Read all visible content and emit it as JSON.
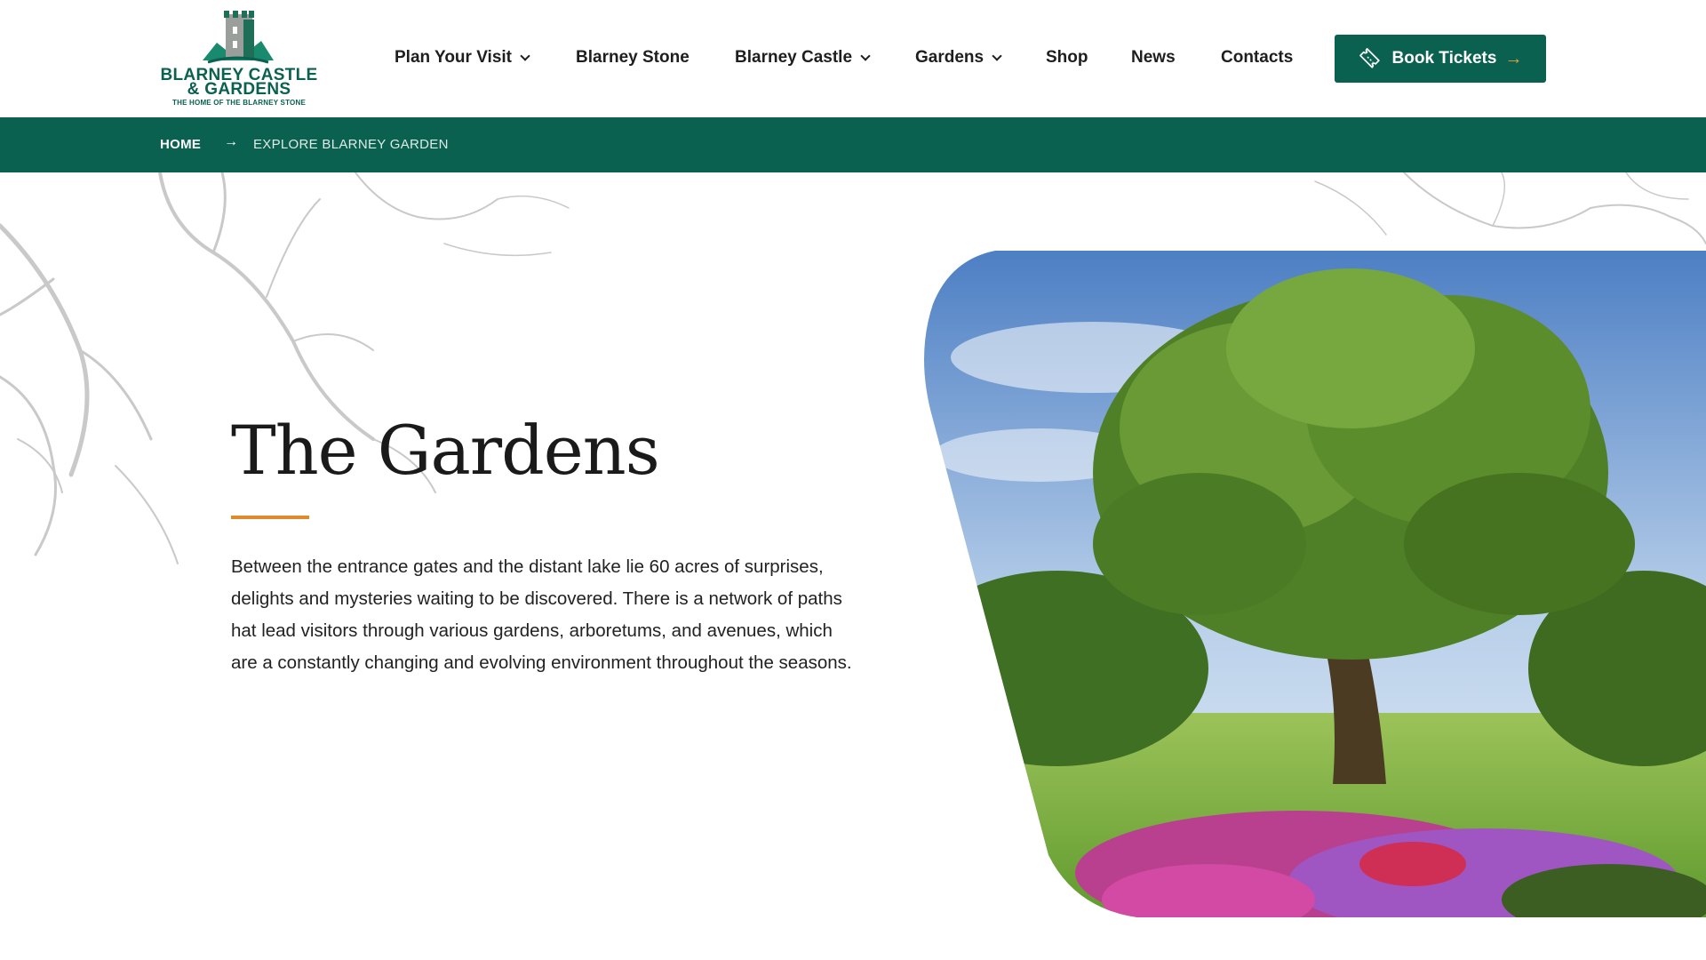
{
  "brand": {
    "name_line1": "BLARNEY CASTLE",
    "name_line2": "& GARDENS",
    "tagline": "THE HOME OF THE BLARNEY STONE",
    "colors": {
      "primary": "#0b6150",
      "accent": "#e08a2b"
    }
  },
  "nav": {
    "items": [
      {
        "label": "Plan Your Visit",
        "has_dropdown": true
      },
      {
        "label": "Blarney Stone",
        "has_dropdown": false
      },
      {
        "label": "Blarney Castle",
        "has_dropdown": true
      },
      {
        "label": "Gardens",
        "has_dropdown": true
      },
      {
        "label": "Shop",
        "has_dropdown": false
      },
      {
        "label": "News",
        "has_dropdown": false
      },
      {
        "label": "Contacts",
        "has_dropdown": false
      }
    ],
    "cta": {
      "label": "Book Tickets",
      "icon": "ticket-icon",
      "arrow_icon": "arrow-right-icon"
    }
  },
  "breadcrumb": {
    "home": "HOME",
    "separator": "→",
    "current": "EXPLORE BLARNEY GARDEN"
  },
  "hero": {
    "title": "The Gardens",
    "body": "Between the entrance gates and the distant lake lie 60 acres of surprises, delights and mysteries waiting to be discovered. There is a network of paths hat lead visitors through various gardens, arboretums, and avenues, which are a constantly changing and evolving environment throughout the seasons."
  }
}
